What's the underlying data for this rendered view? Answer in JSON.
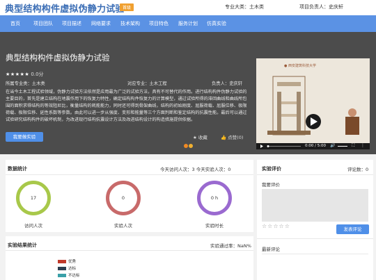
{
  "header": {
    "site_title": "典型结构构件虚拟伪静力试验",
    "badge": "首级",
    "major": "专业大类：土木类",
    "leader": "项目负责人：史庆轩"
  },
  "nav": [
    "首页",
    "项目团队",
    "项目描述",
    "网络要求",
    "技术架构",
    "项目特色",
    "服务计划",
    "仿真实验"
  ],
  "hero": {
    "title": "典型结构构件虚拟伪静力试验",
    "stars": "★★★★★",
    "score": "0.0分",
    "belong_major": "所属专业类：土木类",
    "target_major": "对应专业：土木工程",
    "leader": "负责人：史庆轩",
    "description": "在当今土木工程试验领域，伪静力试验方法依然是应用最为广泛的试验方法，具有不可替代的作用。进行结构构件伪静力试验的主要目的，首先是建立结构在地震作用下的恢复力特性，确定结构构件恢复力的计算模型，通过试验所得的滞回曲线和曲线所包围的面积求得结构的等效阻尼比，衡量结构的耗能能力，同时还可得到骨架曲线，结构的初始刚度、屈服荷载、屈服位移、极限荷载、极限位移、延性系数等参数。由此可以进一步从强度、变形和能量等三个方面判断和鉴定结构的抗震性能。最后可以通过试验研究结构构件的破坏机制，为改进现行结构抗震设计方法及改进结构设计的构造措施提供依据。",
    "experiment_button": "我要做实验",
    "favorite": "收藏",
    "like": "点赞(0)",
    "video_time": "0:00 / 5:00"
  },
  "stats": {
    "title": "数据统计",
    "today": "今天访问人次：3 今天实验人次：0",
    "rings": [
      {
        "value": "17",
        "label": "访问人次",
        "color": "#a8c84a"
      },
      {
        "value": "0",
        "label": "实验人次",
        "color": "#c86a6a"
      },
      {
        "value": "0 h",
        "label": "实验时长",
        "color": "#9a6ad0"
      }
    ]
  },
  "results": {
    "title": "实验结果统计",
    "pass_rate": "实验通过率：NaN%",
    "legend": [
      {
        "label": "优秀",
        "color": "#c0392b"
      },
      {
        "label": "达标",
        "color": "#2c3e50"
      },
      {
        "label": "不达标",
        "color": "#3aa0a8"
      }
    ]
  },
  "evaluation": {
    "title": "实验评价",
    "count": "评论数：0",
    "my_eval": "我要评价",
    "rating_stars": "☆☆☆☆☆",
    "submit": "发表评论",
    "latest": "最新评论"
  }
}
